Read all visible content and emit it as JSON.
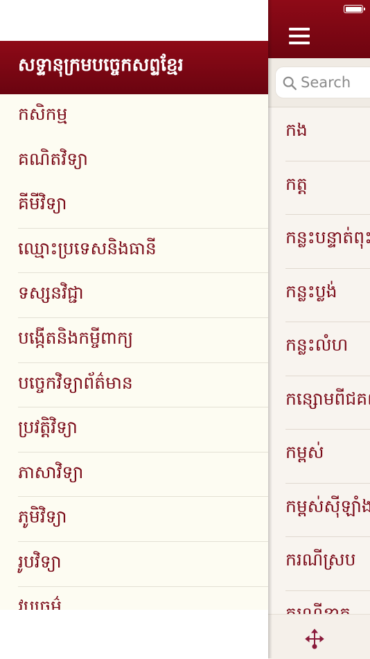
{
  "main": {
    "search": {
      "placeholder": "Search"
    },
    "words": [
      "កង",
      "កត្ត",
      "កន្លះបន្ទាត់ពុះ",
      "កន្លះប្លង់",
      "កន្លះលំហ",
      "កន្សោមពីជគណិត",
      "កម្ពស់",
      "កម្ពស់ស៊ីឡាំង",
      "ករណីស្រប",
      "ករណីខាត"
    ]
  },
  "drawer": {
    "title": "សទ្ទានុក្រមបច្ចេកសព្ទខ្មែរ",
    "categories": [
      "កសិកម្ម",
      "គណិតវិទ្យា",
      "គីមីវិទ្យា",
      "ឈ្មោះប្រទេសនិងធានី",
      "ទស្សនវិជ្ជា",
      "បង្កើតនិងកម្ចីពាក្យ",
      "បច្ចេកវិទ្យាព័ត៌មាន",
      "ប្រវត្តិវិទ្យា",
      "ភាសាវិទ្យា",
      "ភូមិវិទ្យា",
      "រូបវិទ្យា",
      "វប្បធម៌"
    ]
  },
  "icons": {
    "menu": "hamburger-icon",
    "search": "search-icon",
    "move": "move-arrows-icon",
    "battery": "battery-icon"
  },
  "colors": {
    "brand": "#7a0a18",
    "header": "#8e0a17",
    "drawer_bg": "#fdfcf2",
    "main_bg": "#f8f4ef"
  }
}
